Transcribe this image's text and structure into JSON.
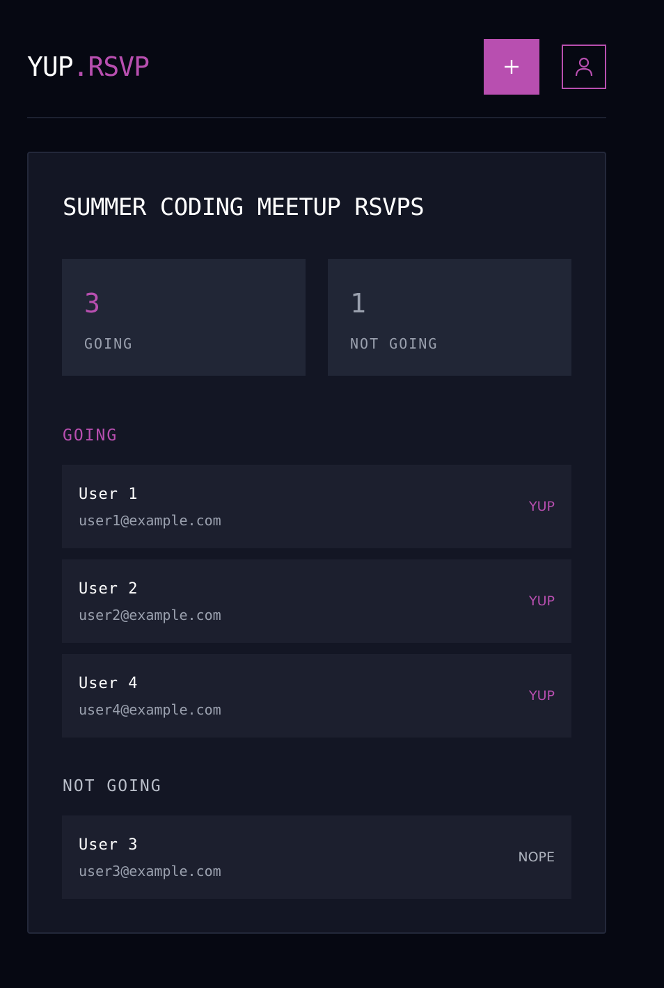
{
  "brand": {
    "part1": "YUP",
    "dot": ".",
    "part2": "RSVP",
    "accent_color": "#b84fb0"
  },
  "header": {
    "add_icon": "plus-icon",
    "profile_icon": "user-icon"
  },
  "event": {
    "title": "SUMMER CODING MEETUP RSVPS"
  },
  "stats": {
    "going_count": "3",
    "going_label": "GOING",
    "not_going_count": "1",
    "not_going_label": "NOT GOING"
  },
  "sections": {
    "going": {
      "heading": "GOING",
      "rows": [
        {
          "name": "User 1",
          "email": "user1@example.com",
          "status": "YUP"
        },
        {
          "name": "User 2",
          "email": "user2@example.com",
          "status": "YUP"
        },
        {
          "name": "User 4",
          "email": "user4@example.com",
          "status": "YUP"
        }
      ]
    },
    "not_going": {
      "heading": "NOT GOING",
      "rows": [
        {
          "name": "User 3",
          "email": "user3@example.com",
          "status": "NOPE"
        }
      ]
    }
  }
}
